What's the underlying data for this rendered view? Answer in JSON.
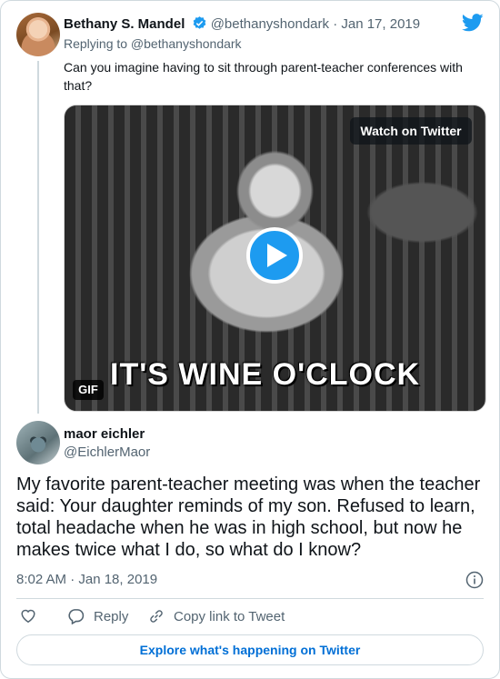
{
  "reply_tweet": {
    "author_name": "Bethany S. Mandel",
    "handle": "@bethanyshondark",
    "date": "· Jan 17, 2019",
    "replying_to": "Replying to @bethanyshondark",
    "text": "Can you imagine having to sit through parent-teacher conferences with that?",
    "media": {
      "watch_label": "Watch on Twitter",
      "caption": "IT'S WINE O'CLOCK",
      "badge": "GIF"
    }
  },
  "main_tweet": {
    "author_name": "maor eichler",
    "handle": "@EichlerMaor",
    "text": "My favorite parent-teacher meeting was when the teacher said: Your daughter reminds of my son. Refused to learn, total headache when he was in high school, but now he makes twice what I do, so what do I know?",
    "timestamp": "8:02 AM · Jan 18, 2019"
  },
  "actions": {
    "reply_label": "Reply",
    "copy_label": "Copy link to Tweet"
  },
  "explore_label": "Explore what's happening on Twitter",
  "colors": {
    "accent": "#1d9bf0",
    "link": "#006fd6",
    "muted": "#536471",
    "border": "#cfd9de"
  },
  "icons": [
    "verified-badge-icon",
    "twitter-bird-icon",
    "play-icon",
    "info-icon",
    "heart-icon",
    "reply-icon",
    "link-icon"
  ]
}
